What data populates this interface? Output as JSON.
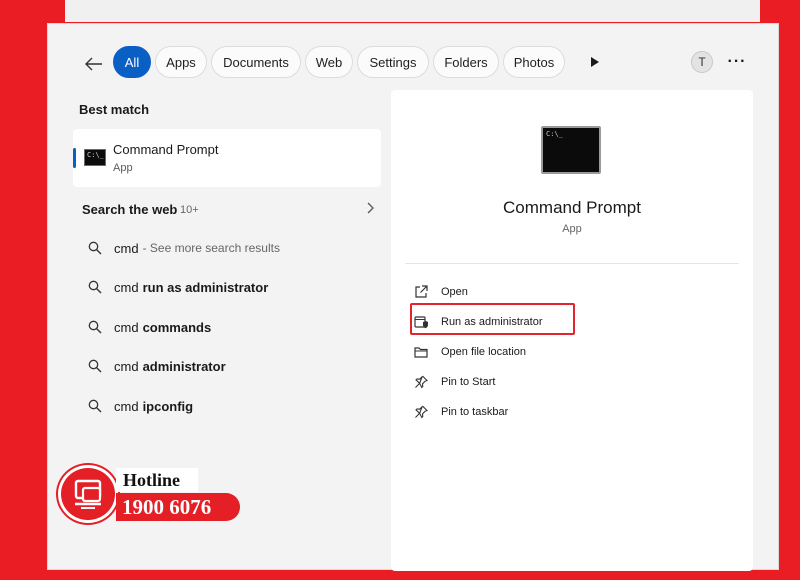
{
  "filters": {
    "back_icon": "arrow-left-icon",
    "tabs": [
      {
        "label": "All",
        "active": true
      },
      {
        "label": "Apps",
        "active": false
      },
      {
        "label": "Documents",
        "active": false
      },
      {
        "label": "Web",
        "active": false
      },
      {
        "label": "Settings",
        "active": false
      },
      {
        "label": "Folders",
        "active": false
      },
      {
        "label": "Photos",
        "active": false
      }
    ],
    "play_icon": "play-icon",
    "avatar_initial": "T",
    "more_label": "···"
  },
  "best_match": {
    "heading": "Best match",
    "app_name": "Command Prompt",
    "app_type": "App",
    "icon": "cmd-app-icon",
    "icon_glyph": "C:\\_"
  },
  "web": {
    "heading": "Search the web",
    "count": "10+",
    "suggestions": [
      {
        "query": "cmd",
        "rest": "",
        "hint": "- See more search results"
      },
      {
        "query": "cmd",
        "rest": "run as administrator",
        "hint": ""
      },
      {
        "query": "cmd",
        "rest": "commands",
        "hint": ""
      },
      {
        "query": "cmd",
        "rest": "administrator",
        "hint": ""
      },
      {
        "query": "cmd",
        "rest": "ipconfig",
        "hint": ""
      }
    ]
  },
  "detail": {
    "title": "Command Prompt",
    "type": "App",
    "actions": [
      {
        "label": "Open",
        "icon": "open-external-icon"
      },
      {
        "label": "Run as administrator",
        "icon": "shield-window-icon",
        "highlighted": true
      },
      {
        "label": "Open file location",
        "icon": "folder-icon"
      },
      {
        "label": "Pin to Start",
        "icon": "pin-icon"
      },
      {
        "label": "Pin to taskbar",
        "icon": "pin-icon"
      }
    ]
  },
  "hotline": {
    "label": "Hotline",
    "number": "1900 6076"
  },
  "colors": {
    "accent": "#0a5fc4",
    "frame": "#ea1c24",
    "highlight": "#e3232d"
  }
}
